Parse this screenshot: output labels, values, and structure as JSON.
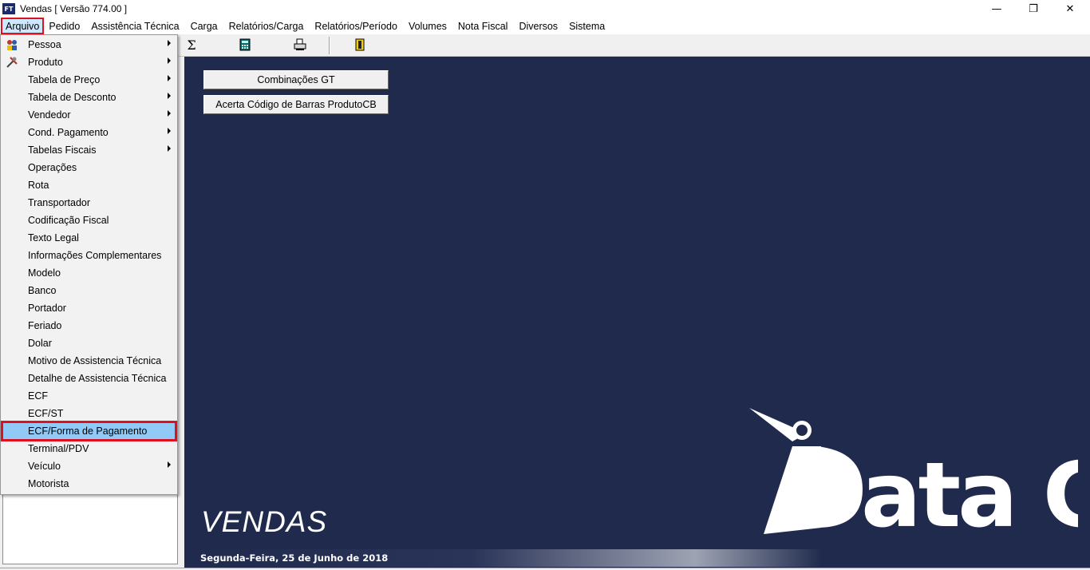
{
  "window": {
    "app_icon": "FT",
    "title": "Vendas [ Versão 774.00 ]",
    "minimize_glyph": "—",
    "restore_glyph": "❐",
    "close_glyph": "✕"
  },
  "menubar": [
    {
      "label": "Arquivo",
      "active": true
    },
    {
      "label": "Pedido"
    },
    {
      "label": "Assistência Técnica"
    },
    {
      "label": "Carga"
    },
    {
      "label": "Relatórios/Carga"
    },
    {
      "label": "Relatórios/Período"
    },
    {
      "label": "Volumes"
    },
    {
      "label": "Nota Fiscal"
    },
    {
      "label": "Diversos"
    },
    {
      "label": "Sistema"
    }
  ],
  "toolbar": {
    "icons": [
      "sigma-icon",
      "calculator-icon",
      "printer-icon",
      "exit-door-icon"
    ],
    "sigma": "Σ",
    "calculator": "▦",
    "printer": "⎙",
    "exit": "▮"
  },
  "arquivo_menu": [
    {
      "label": "Pessoa",
      "submenu": true,
      "icon": "people-icon"
    },
    {
      "label": "Produto",
      "submenu": true,
      "icon": "tools-icon"
    },
    {
      "label": "Tabela de Preço",
      "submenu": true
    },
    {
      "label": "Tabela de Desconto",
      "submenu": true
    },
    {
      "label": "Vendedor",
      "submenu": true
    },
    {
      "label": "Cond. Pagamento",
      "submenu": true
    },
    {
      "label": "Tabelas Fiscais",
      "submenu": true
    },
    {
      "label": "Operações"
    },
    {
      "label": "Rota"
    },
    {
      "label": "Transportador"
    },
    {
      "label": "Codificação Fiscal"
    },
    {
      "label": "Texto Legal"
    },
    {
      "label": "Informações Complementares"
    },
    {
      "label": "Modelo"
    },
    {
      "label": "Banco"
    },
    {
      "label": "Portador"
    },
    {
      "label": "Feriado"
    },
    {
      "label": "Dolar"
    },
    {
      "label": "Motivo de Assistencia Técnica"
    },
    {
      "label": "Detalhe de Assistencia Técnica"
    },
    {
      "label": "ECF"
    },
    {
      "label": "ECF/ST"
    },
    {
      "label": "ECF/Forma de Pagamento",
      "highlight": true
    },
    {
      "label": "Terminal/PDV"
    },
    {
      "label": "Veículo",
      "submenu": true
    },
    {
      "label": "Motorista"
    }
  ],
  "main": {
    "buttons": [
      "Combinações GT",
      "Acerta Código de Barras ProdutoCB"
    ],
    "app_name": "VENDAS",
    "date": "Segunda-Feira, 25 de Junho de 2018",
    "logo_text": "Data C",
    "logo_display": "ata C"
  },
  "colors": {
    "main_bg": "#1f2a4d",
    "highlight": "#91c9f7",
    "annotation_red": "#e0101e"
  }
}
